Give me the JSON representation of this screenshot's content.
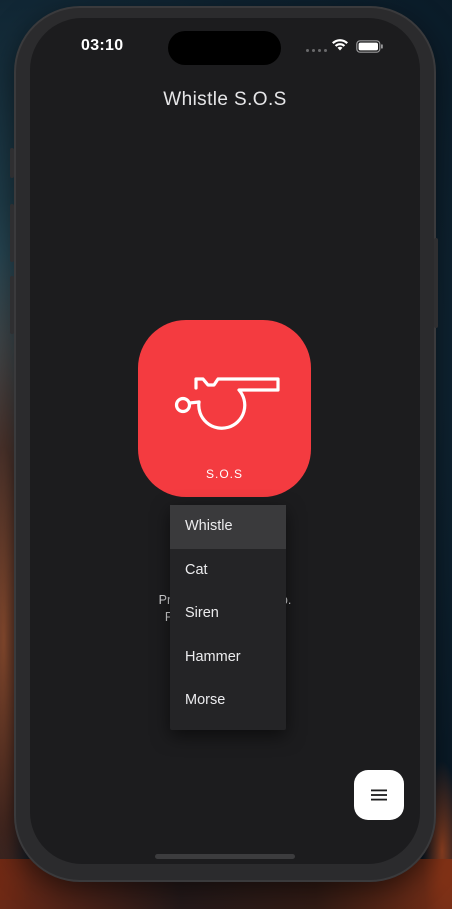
{
  "status_bar": {
    "time": "03:10",
    "icons": [
      "cellular-dots-icon",
      "wifi-icon",
      "battery-icon"
    ]
  },
  "app": {
    "title": "Whistle S.O.S"
  },
  "sos_button": {
    "label": "S.O.S",
    "icon": "whistle-icon",
    "color": "#f43b40"
  },
  "instructions": {
    "line1": "Pres                         elp.",
    "line2": "Pr                            p."
  },
  "sound_menu": {
    "selected": "Whistle",
    "items": [
      "Whistle",
      "Cat",
      "Siren",
      "Hammer",
      "Morse"
    ]
  },
  "fab": {
    "icon": "hamburger-menu-icon"
  },
  "colors": {
    "screen_bg": "#1c1c1e",
    "menu_bg": "#242426",
    "menu_selected_bg": "#3a3a3c"
  }
}
